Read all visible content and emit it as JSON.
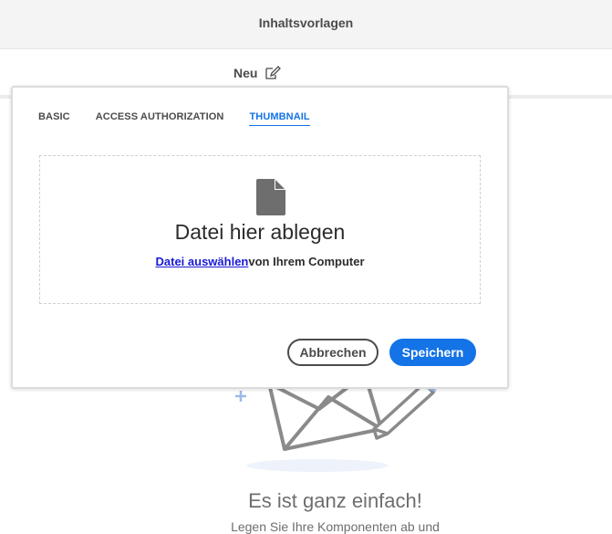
{
  "header": {
    "title": "Inhaltsvorlagen"
  },
  "toolbar": {
    "new_label": "Neu",
    "new_icon": "edit-icon"
  },
  "empty_state": {
    "title": "Es ist ganz einfach!",
    "description": "Legen Sie Ihre Komponenten ab und"
  },
  "dialog": {
    "tabs": [
      {
        "label": "BASIC",
        "active": false
      },
      {
        "label": "ACCESS AUTHORIZATION",
        "active": false
      },
      {
        "label": "THUMBNAIL",
        "active": true
      }
    ],
    "dropzone": {
      "icon": "file-icon",
      "title": "Datei hier ablegen",
      "link_text": "Datei auswählen",
      "suffix_text": "von Ihrem Computer"
    },
    "cancel_label": "Abbrechen",
    "save_label": "Speichern"
  },
  "colors": {
    "accent": "#1473e6",
    "link": "#1a1ad6"
  }
}
